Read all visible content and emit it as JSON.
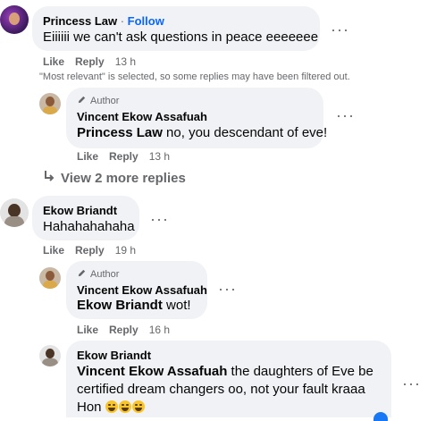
{
  "comments": {
    "c1": {
      "author": "Princess Law",
      "separator": " · ",
      "follow": "Follow",
      "text": "Eiiiiii we can't ask questions in peace eeeeeee",
      "like": "Like",
      "reply": "Reply",
      "time": "13 h"
    },
    "filter_notice": "\"Most relevant\" is selected, so some replies may have been filtered out.",
    "r1": {
      "badge": "Author",
      "author": "Vincent Ekow Assafuah",
      "mention": "Princess Law",
      "text": " no, you descendant of eve!",
      "like": "Like",
      "reply": "Reply",
      "time": "13 h"
    },
    "view_more": "View 2 more replies",
    "c2": {
      "author": "Ekow Briandt",
      "text": "Hahahahahaha",
      "like": "Like",
      "reply": "Reply",
      "time": "19 h"
    },
    "r2": {
      "badge": "Author",
      "author": "Vincent Ekow Assafuah",
      "mention": "Ekow Briandt",
      "text": " wot!",
      "like": "Like",
      "reply": "Reply",
      "time": "16 h"
    },
    "r3": {
      "author": "Ekow Briandt",
      "mention": "Vincent Ekow Assafuah",
      "text_line1": " the daughters of Eve be",
      "text_line2": "certified dream changers oo, not your fault kraaa",
      "text_line3": "Hon"
    }
  },
  "icons": {
    "more": "more-options-icon",
    "reply_arrow": "reply-arrow-icon",
    "author_badge": "pencil-icon",
    "emoji": "laughing-emoji-icon"
  },
  "colors": {
    "bubble": "#f0f2f5",
    "link_blue": "#0866ff",
    "muted": "#65676b"
  }
}
